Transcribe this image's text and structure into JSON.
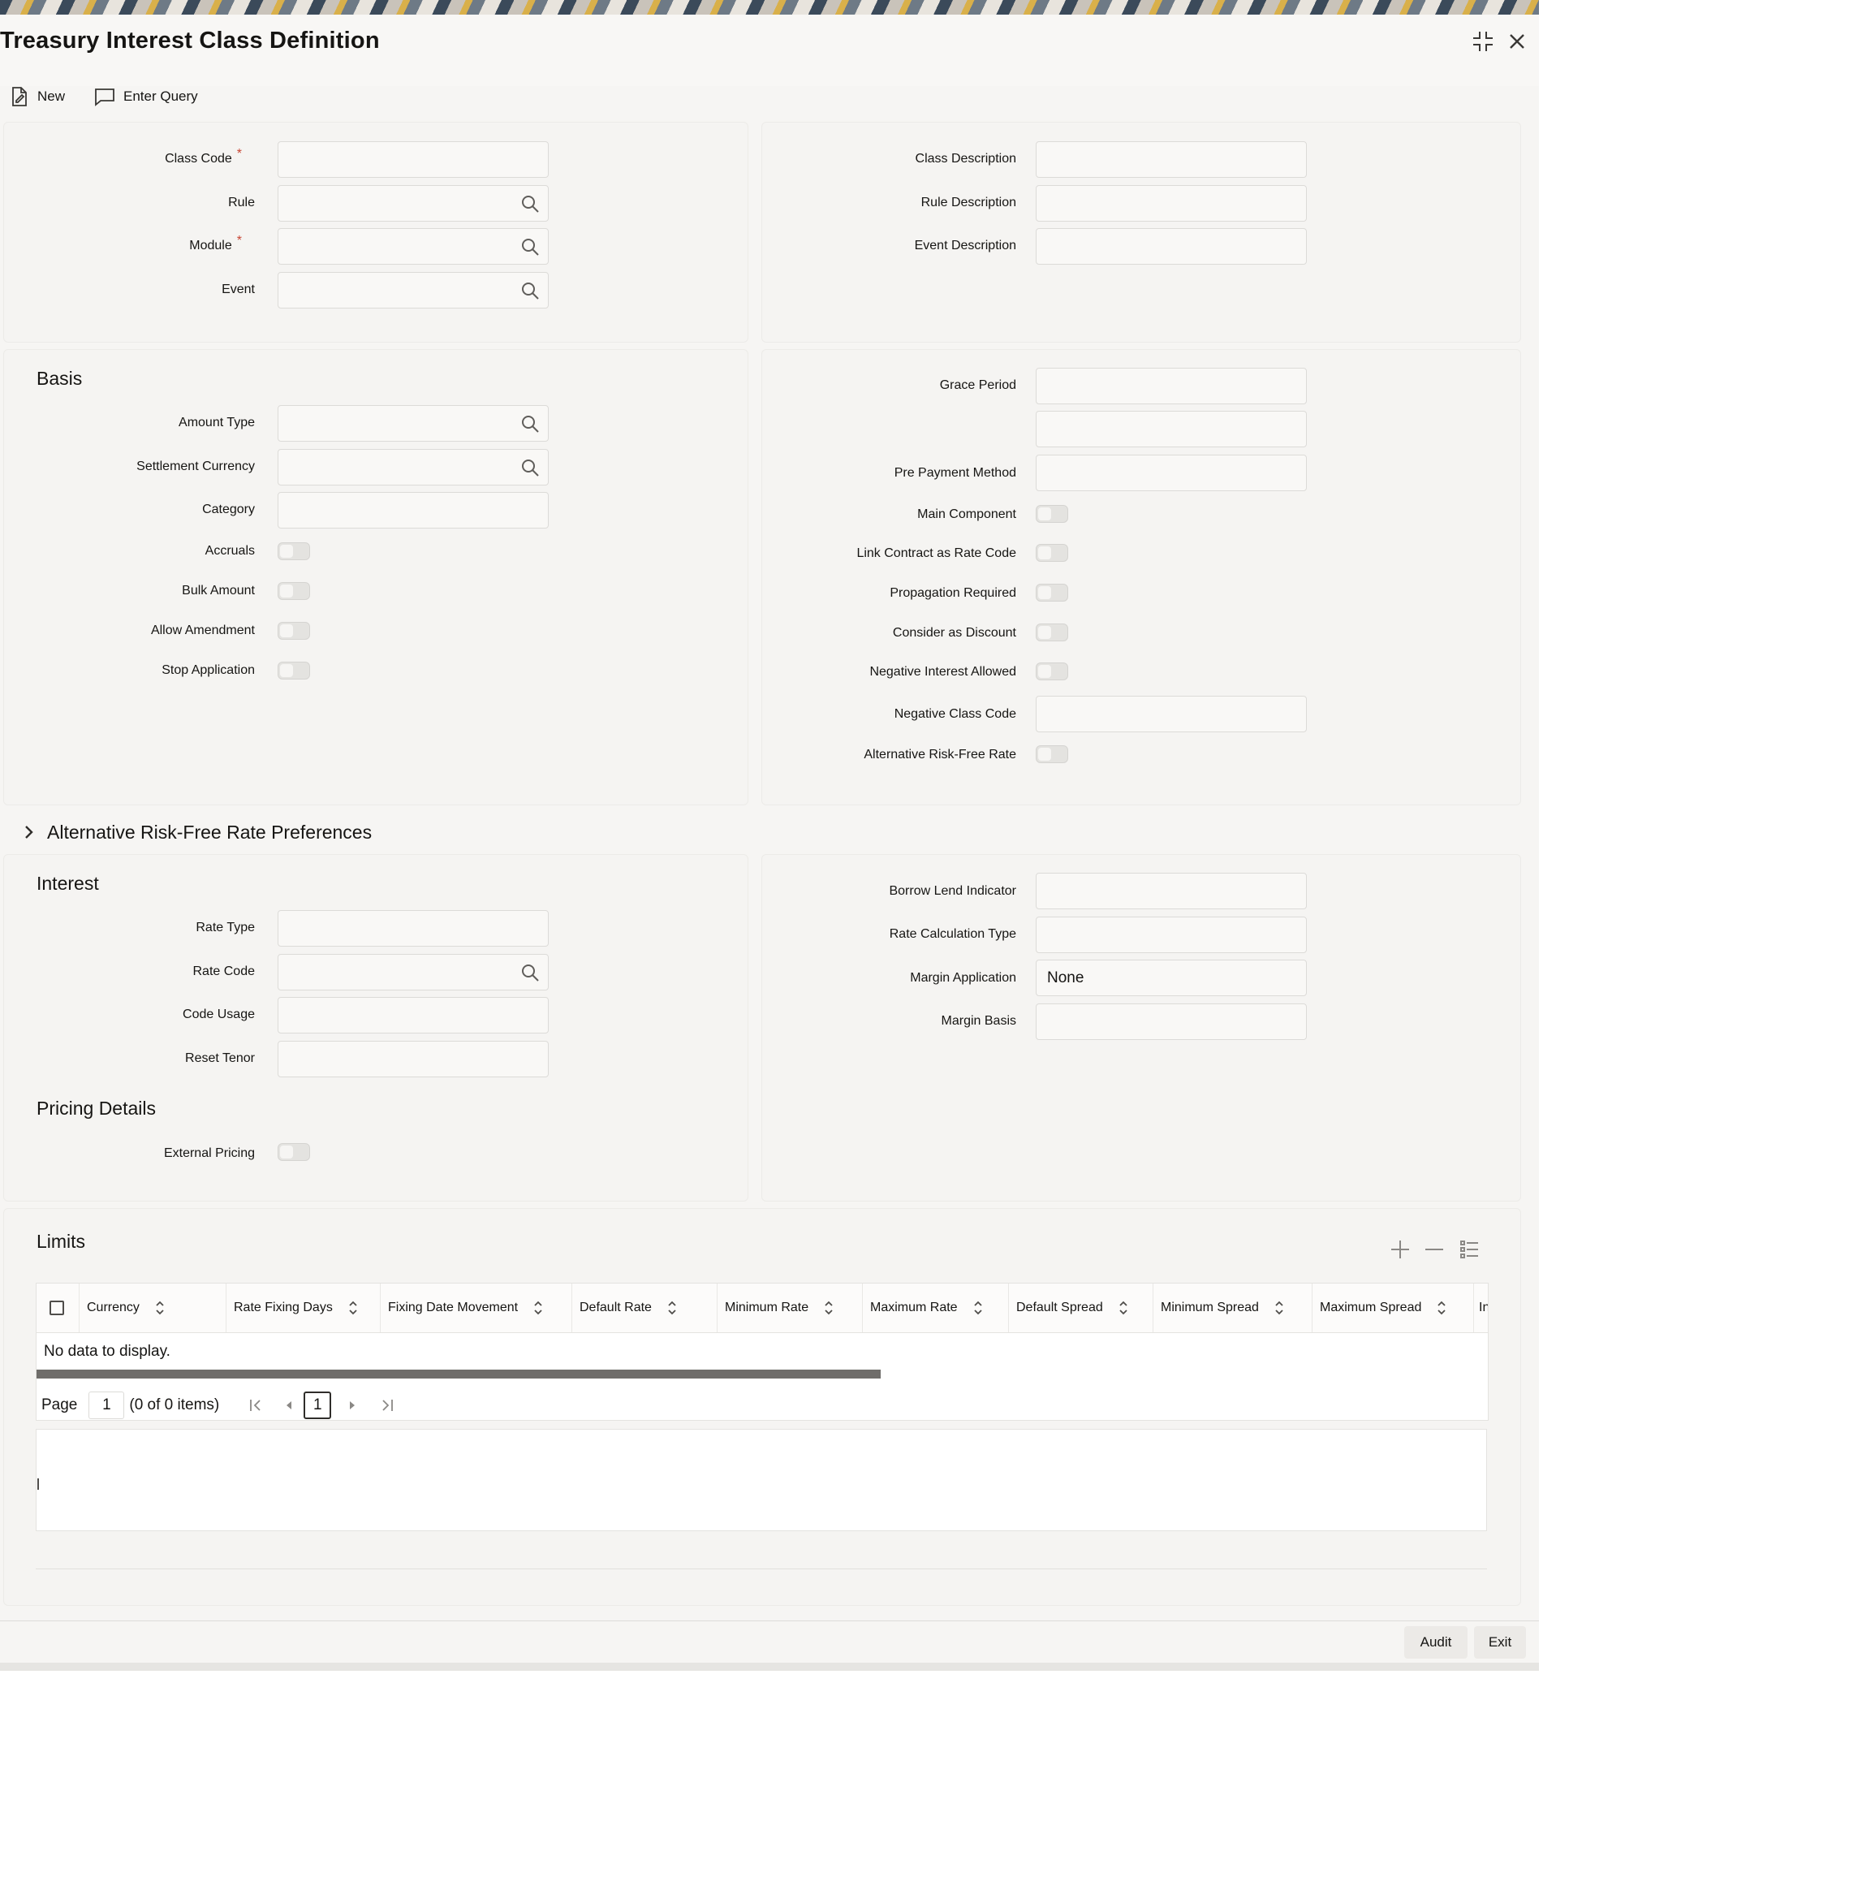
{
  "window": {
    "title": "Treasury Interest Class Definition"
  },
  "toolbar": {
    "new_label": "New",
    "enter_query_label": "Enter Query"
  },
  "header_section": {
    "class_code_label": "Class Code",
    "rule_label": "Rule",
    "module_label": "Module",
    "event_label": "Event",
    "class_description_label": "Class Description",
    "rule_description_label": "Rule Description",
    "event_description_label": "Event Description",
    "required_mark": "*"
  },
  "basis": {
    "title": "Basis",
    "amount_type_label": "Amount Type",
    "settlement_currency_label": "Settlement Currency",
    "category_label": "Category",
    "accruals_label": "Accruals",
    "bulk_amount_label": "Bulk Amount",
    "allow_amendment_label": "Allow Amendment",
    "stop_application_label": "Stop Application"
  },
  "basis_right": {
    "grace_period_label": "Grace Period",
    "pre_payment_method_label": "Pre Payment Method",
    "main_component_label": "Main Component",
    "link_contract_label": "Link Contract as Rate Code",
    "propagation_required_label": "Propagation Required",
    "consider_as_discount_label": "Consider as Discount",
    "negative_interest_allowed_label": "Negative Interest Allowed",
    "negative_class_code_label": "Negative Class Code",
    "alternative_rfr_label": "Alternative Risk-Free Rate"
  },
  "arfr_preferences": {
    "title": "Alternative Risk-Free Rate Preferences"
  },
  "interest": {
    "title": "Interest",
    "rate_type_label": "Rate Type",
    "rate_code_label": "Rate Code",
    "code_usage_label": "Code Usage",
    "reset_tenor_label": "Reset Tenor",
    "borrow_lend_indicator_label": "Borrow Lend Indicator",
    "rate_calculation_type_label": "Rate Calculation Type",
    "margin_application_label": "Margin Application",
    "margin_application_value": "None",
    "margin_basis_label": "Margin Basis"
  },
  "pricing": {
    "title": "Pricing Details",
    "external_pricing_label": "External Pricing"
  },
  "limits": {
    "title": "Limits",
    "columns": [
      "Currency",
      "Rate Fixing Days",
      "Fixing Date Movement",
      "Default Rate",
      "Minimum Rate",
      "Maximum Rate",
      "Default Spread",
      "Minimum Spread",
      "Maximum Spread",
      "In"
    ],
    "empty_text": "No data to display.",
    "page_label": "Page",
    "page_input_value": "1",
    "items_text": "(0 of 0 items)",
    "current_page": "1"
  },
  "footer": {
    "audit_label": "Audit",
    "exit_label": "Exit"
  },
  "colors": {
    "required": "#c74634",
    "panel": "#f5f4f2",
    "scrollbar": "#6f6d6a"
  }
}
